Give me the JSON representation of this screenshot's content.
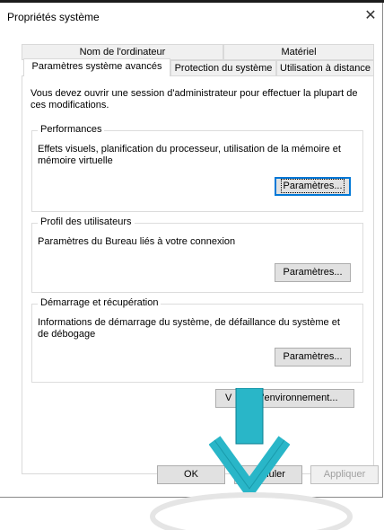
{
  "window": {
    "title": "Propriétés système",
    "close_glyph": "✕"
  },
  "tabs": {
    "row1": [
      "Nom de l'ordinateur",
      "Matériel"
    ],
    "row2": [
      "Paramètres système avancés",
      "Protection du système",
      "Utilisation à distance"
    ]
  },
  "intro": "Vous devez ouvrir une session d'administrateur pour effectuer la plupart de ces modifications.",
  "performances": {
    "title": "Performances",
    "description": "Effets visuels, planification du processeur, utilisation de la mémoire et mémoire virtuelle",
    "button": "Paramètres..."
  },
  "profil": {
    "title": "Profil des utilisateurs",
    "description": "Paramètres du Bureau liés à votre connexion",
    "button": "Paramètres..."
  },
  "demarrage": {
    "title": "Démarrage et récupération",
    "description": "Informations de démarrage du système, de défaillance du système et de débogage",
    "button": "Paramètres..."
  },
  "env_button": {
    "prefix": "V",
    "suffix": "d'environnement..."
  },
  "footer": {
    "ok": "OK",
    "annuler": "Annuler",
    "appliquer": "Appliquer"
  },
  "overlay": {
    "arrow_icon": "down-arrow-icon",
    "arrow_color": "#29b6c8"
  }
}
